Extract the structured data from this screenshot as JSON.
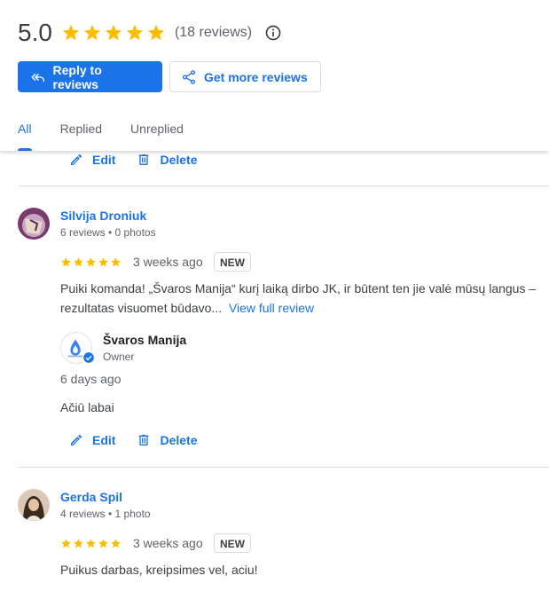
{
  "summary": {
    "rating": "5.0",
    "stars": 5,
    "review_count": "(18 reviews)",
    "star_color": "#fbbc04"
  },
  "buttons": {
    "reply": "Reply to reviews",
    "get_more": "Get more reviews"
  },
  "tabs": [
    "All",
    "Replied",
    "Unreplied"
  ],
  "active_tab": "All",
  "actions": {
    "edit": "Edit",
    "delete": "Delete"
  },
  "reviews": [
    {
      "name": "Silvija Droniuk",
      "meta": "6 reviews • 0 photos",
      "rating": 5,
      "time": "3 weeks ago",
      "badge": "NEW",
      "text_line1": "Puiki komanda! „Švaros Manija“ kurį laiką dirbo JK, ir būtent ten jie valė mūsų langus –",
      "text_line2": "rezultatas visuomet būdavo...",
      "view_full": "View full review",
      "reply": {
        "owner_name": "Švaros Manija",
        "owner_role": "Owner",
        "time": "6 days ago",
        "text": "Ačiū labai"
      }
    },
    {
      "name": "Gerda Spil",
      "meta": "4 reviews • 1 photo",
      "rating": 5,
      "time": "3 weeks ago",
      "badge": "NEW",
      "text_line1": "Puikus darbas, kreipsimes vel, aciu!"
    }
  ]
}
